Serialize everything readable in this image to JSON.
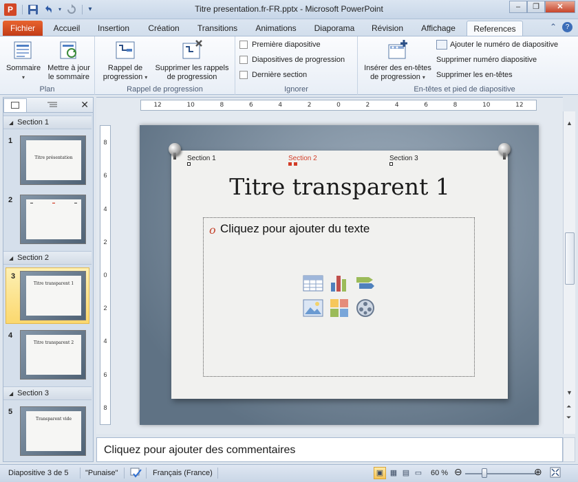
{
  "window": {
    "title": "Titre presentation.fr-FR.pptx - Microsoft PowerPoint",
    "app_icon_letter": "P",
    "controls": [
      "–",
      "❐",
      "✕"
    ]
  },
  "qat": {
    "save_icon": "save-icon",
    "undo_icon": "undo-icon",
    "redo_icon": "redo-icon",
    "customize_icon": "chevron-down-icon"
  },
  "tabs": [
    {
      "label": "Fichier"
    },
    {
      "label": "Accueil"
    },
    {
      "label": "Insertion"
    },
    {
      "label": "Création"
    },
    {
      "label": "Transitions"
    },
    {
      "label": "Animations"
    },
    {
      "label": "Diaporama"
    },
    {
      "label": "Révision"
    },
    {
      "label": "Affichage"
    },
    {
      "label": "References"
    }
  ],
  "ribbon": {
    "groups": {
      "plan": {
        "label": "Plan",
        "sommaire": "Sommaire",
        "mettre_a_jour_1": "Mettre à jour",
        "mettre_a_jour_2": "le sommaire"
      },
      "progression": {
        "label": "Rappel de progression",
        "rappel_1": "Rappel de",
        "rappel_2": "progression",
        "supprimer_1": "Supprimer les rappels",
        "supprimer_2": "de progression"
      },
      "ignorer": {
        "label": "Ignorer",
        "options": [
          "Première diapositive",
          "Diapositives de progression",
          "Dernière section"
        ]
      },
      "entetes": {
        "label": "En-têtes et pied de diapositive",
        "inserer_1": "Insérer des en-têtes",
        "inserer_2": "de progression",
        "ajouter_numero": "Ajouter le numéro de diapositive",
        "supprimer_numero": "Supprimer numéro diapositive",
        "supprimer_entetes": "Supprimer les en-têtes"
      }
    }
  },
  "left_panel": {
    "sections": [
      {
        "name": "Section 1"
      },
      {
        "name": "Section 2"
      },
      {
        "name": "Section 3"
      }
    ],
    "slides": [
      {
        "num": "1",
        "title": "Titre présentation"
      },
      {
        "num": "2",
        "title": ""
      },
      {
        "num": "3",
        "title": "Titre transparent 1"
      },
      {
        "num": "4",
        "title": "Titre transparent 2"
      },
      {
        "num": "5",
        "title": "Transparent vide"
      }
    ]
  },
  "ruler": {
    "h_ticks": [
      "12",
      "10",
      "8",
      "6",
      "4",
      "2",
      "0",
      "2",
      "4",
      "6",
      "8",
      "10",
      "12"
    ],
    "v_ticks": [
      "8",
      "6",
      "4",
      "2",
      "0",
      "2",
      "4",
      "6",
      "8"
    ]
  },
  "slide": {
    "sections": [
      "Section 1",
      "Section 2",
      "Section 3"
    ],
    "title": "Titre transparent 1",
    "bullet": "o",
    "placeholder": "Cliquez pour ajouter du texte"
  },
  "notes": {
    "placeholder": "Cliquez pour ajouter des commentaires"
  },
  "status": {
    "slide_info": "Diapositive 3 de 5",
    "theme": "\"Punaise\"",
    "language": "Français (France)",
    "zoom": "60 %"
  },
  "colors": {
    "file_tab": "#d24726",
    "active_section": "#d23c27",
    "selected_thumb": "#fbd86e"
  }
}
